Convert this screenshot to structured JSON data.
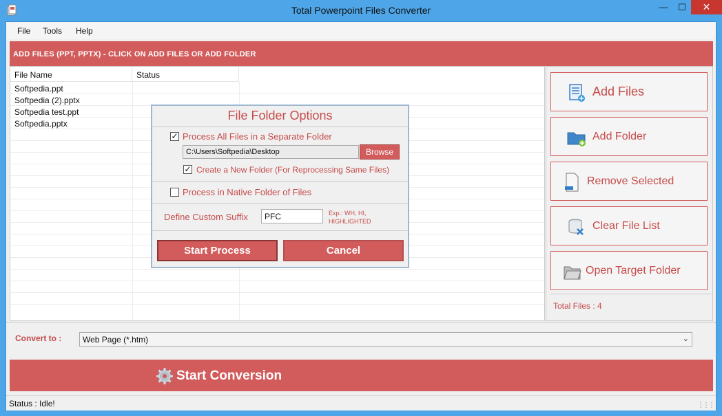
{
  "window": {
    "title": "Total Powerpoint Files Converter"
  },
  "menu": {
    "items": [
      "File",
      "Tools",
      "Help"
    ]
  },
  "header": {
    "text": "ADD FILES (PPT, PPTX) - CLICK ON ADD FILES OR ADD FOLDER"
  },
  "file_list": {
    "columns": [
      "File Name",
      "Status"
    ],
    "rows": [
      {
        "name": "Softpedia.ppt",
        "status": ""
      },
      {
        "name": "Softpedia (2).pptx",
        "status": ""
      },
      {
        "name": "Softpedia test.ppt",
        "status": ""
      },
      {
        "name": "Softpedia.pptx",
        "status": ""
      }
    ]
  },
  "side_buttons": {
    "add_files": "Add Files",
    "add_folder": "Add Folder",
    "remove_selected": "Remove Selected",
    "clear_file_list": "Clear File List",
    "open_target_folder": "Open Target Folder"
  },
  "total_files": "Total Files : 4",
  "convert": {
    "label": "Convert to :",
    "selected": "Web Page (*.htm)"
  },
  "start_conversion": "Start Conversion",
  "status": "Status  :  Idle!",
  "dialog": {
    "title": "File Folder Options",
    "separate_folder_label": "Process All Files in a Separate Folder",
    "separate_folder_checked": true,
    "path_value": "C:\\Users\\Softpedia\\Desktop",
    "browse_label": "Browse",
    "new_folder_label": "Create a New Folder (For Reprocessing Same Files)",
    "new_folder_checked": true,
    "native_folder_label": "Process in Native Folder of Files",
    "native_folder_checked": false,
    "suffix_label": "Define Custom Suffix",
    "suffix_value": "PFC",
    "suffix_hint_1": "Exp.: WH, HI,",
    "suffix_hint_2": "HIGHLIGHTED",
    "start_process": "Start Process",
    "cancel": "Cancel"
  },
  "colors": {
    "accent": "#d25b5b",
    "accent_text": "#c74a4a",
    "title_bar": "#4ea6e8"
  }
}
